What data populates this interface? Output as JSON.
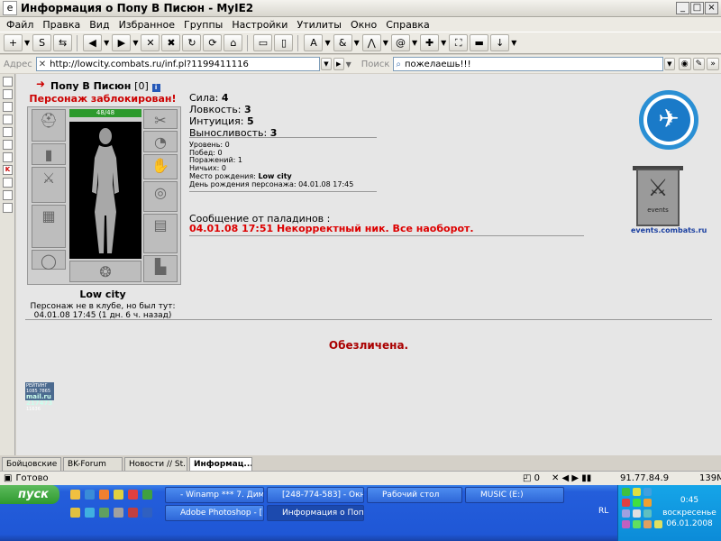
{
  "window": {
    "title": "Информация о Попу В Писюн - MyIE2"
  },
  "menu": [
    "Файл",
    "Правка",
    "Вид",
    "Избранное",
    "Группы",
    "Настройки",
    "Утилиты",
    "Окно",
    "Справка"
  ],
  "address": {
    "label": "Адрес",
    "url": "http://lowcity.combats.ru/inf.pl?1199411116",
    "search_label": "Поиск",
    "search_value": "пожелаешь!!!"
  },
  "character": {
    "name": "Попу В Писюн",
    "level": "[0]",
    "blocked": "Персонаж заблокирован!",
    "hp": "48/48",
    "city": "Low city",
    "club_line": "Персонаж не в клубе, но был тут:",
    "last_seen": "04.01.08 17:45 (1 дн. 6 ч. назад)"
  },
  "stats": [
    {
      "label": "Сила:",
      "value": "4"
    },
    {
      "label": "Ловкость:",
      "value": "3"
    },
    {
      "label": "Интуиция:",
      "value": "5"
    },
    {
      "label": "Выносливость:",
      "value": "3"
    }
  ],
  "info": [
    {
      "label": "Уровень:",
      "value": "0"
    },
    {
      "label": "Побед:",
      "value": "0"
    },
    {
      "label": "Поражений:",
      "value": "1"
    },
    {
      "label": "Ничьих:",
      "value": "0"
    },
    {
      "label": "Место рождения:",
      "value": "Low city"
    },
    {
      "label": "День рождения персонажа:",
      "value": "04.01.08 17:45"
    }
  ],
  "paladins": {
    "label": "Сообщение от паладинов :",
    "message": "04.01.08 17:51 Некорректный ник. Все наоборот."
  },
  "depersonalized": "Обезличена.",
  "rating": {
    "line1": "РЕЙТИНГ 1085 7865",
    "line2": "mail.ru 217473",
    "line3": "11636"
  },
  "events": {
    "link": "events.combats.ru",
    "banner_text": "events"
  },
  "tabs": [
    "Бойцовские ...",
    "BK-Forum",
    "Новости // St...",
    "Информац..."
  ],
  "status": {
    "text": "Готово",
    "count": "0",
    "ip": "91.77.84.9",
    "memory": "139M"
  },
  "taskbar": {
    "start": "пуск",
    "buttons": [
      "- Winamp *** 7. Дим...",
      "[248-774-583] - Окн...",
      "Рабочий стол",
      "MUSIC (E:)",
      "Adobe Photoshop - [...",
      "Информация о Попу ..."
    ],
    "lang": "RL",
    "time": "0:45",
    "day": "воскресенье",
    "date": "06.01.2008"
  }
}
